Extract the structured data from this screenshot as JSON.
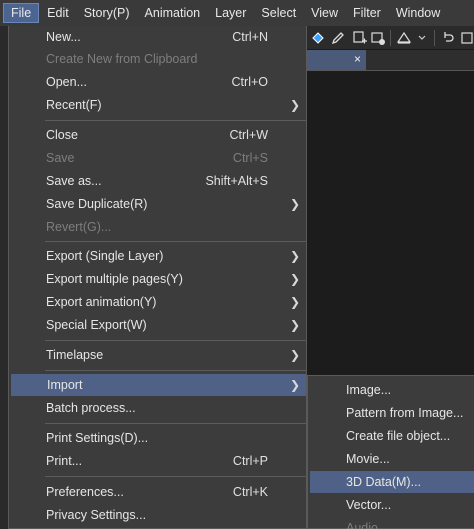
{
  "menubar": {
    "items": [
      {
        "label": "File",
        "active": true
      },
      {
        "label": "Edit"
      },
      {
        "label": "Story(P)"
      },
      {
        "label": "Animation"
      },
      {
        "label": "Layer"
      },
      {
        "label": "Select"
      },
      {
        "label": "View"
      },
      {
        "label": "Filter"
      },
      {
        "label": "Window"
      }
    ]
  },
  "toolbar": {
    "icons": [
      "paint-bucket-icon",
      "pen-icon",
      "copy-to-new-icon",
      "chevron-down-icon",
      "warning-icon",
      "chevron-down-icon",
      "undo-icon",
      "new-canvas-icon"
    ]
  },
  "doc_tab": {
    "close_glyph": "×"
  },
  "file_menu": {
    "items": [
      {
        "label": "New...",
        "shortcut": "Ctrl+N"
      },
      {
        "label": "Create New from Clipboard",
        "disabled": true
      },
      {
        "label": "Open...",
        "shortcut": "Ctrl+O"
      },
      {
        "label": "Recent(F)",
        "submenu": true
      },
      {
        "label": "Close",
        "shortcut": "Ctrl+W"
      },
      {
        "label": "Save",
        "shortcut": "Ctrl+S",
        "disabled": true
      },
      {
        "label": "Save as...",
        "shortcut": "Shift+Alt+S"
      },
      {
        "label": "Save Duplicate(R)",
        "submenu": true
      },
      {
        "label": "Revert(G)...",
        "disabled": true
      },
      {
        "label": "Export (Single Layer)",
        "submenu": true
      },
      {
        "label": "Export multiple pages(Y)",
        "submenu": true
      },
      {
        "label": "Export animation(Y)",
        "submenu": true
      },
      {
        "label": "Special Export(W)",
        "submenu": true
      },
      {
        "label": "Timelapse",
        "submenu": true
      },
      {
        "label": "Import",
        "submenu": true,
        "highlighted": true
      },
      {
        "label": "Batch process..."
      },
      {
        "label": "Print Settings(D)..."
      },
      {
        "label": "Print...",
        "shortcut": "Ctrl+P"
      },
      {
        "label": "Preferences...",
        "shortcut": "Ctrl+K"
      },
      {
        "label": "Privacy Settings..."
      }
    ],
    "submenu_arrow": "❯"
  },
  "import_submenu": {
    "items": [
      {
        "label": "Image..."
      },
      {
        "label": "Pattern from Image..."
      },
      {
        "label": "Create file object..."
      },
      {
        "label": "Movie..."
      },
      {
        "label": "3D Data(M)...",
        "highlighted": true
      },
      {
        "label": "Vector..."
      },
      {
        "label": "Audio",
        "disabled": true
      }
    ]
  }
}
